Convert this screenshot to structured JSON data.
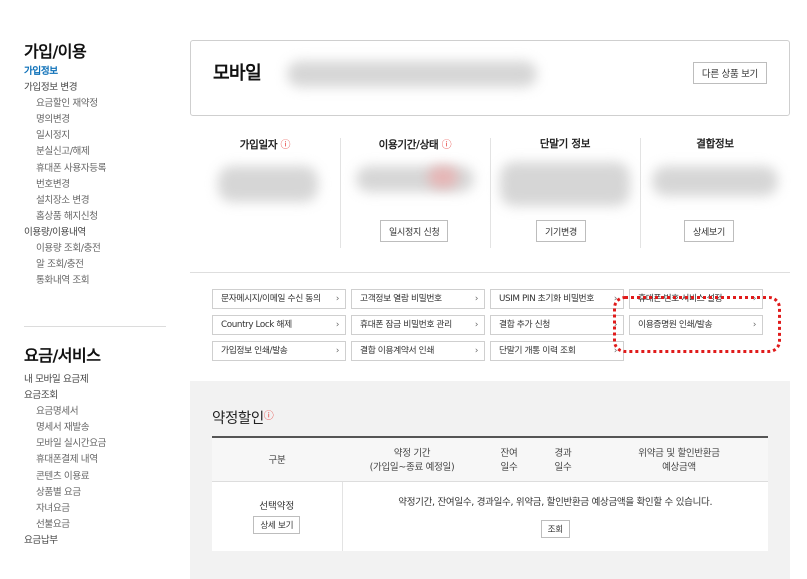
{
  "sidebar": {
    "section1_title": "가입/이용",
    "section1_items": [
      {
        "label": "가입정보",
        "level": 0,
        "active": true
      },
      {
        "label": "가입정보 변경",
        "level": 0
      },
      {
        "label": "요금할인 재약정",
        "level": 1
      },
      {
        "label": "명의변경",
        "level": 1
      },
      {
        "label": "일시정지",
        "level": 1
      },
      {
        "label": "분실신고/해제",
        "level": 1
      },
      {
        "label": "휴대폰 사용자등록",
        "level": 1
      },
      {
        "label": "번호변경",
        "level": 1
      },
      {
        "label": "설치장소 변경",
        "level": 1
      },
      {
        "label": "홈상품 해지신청",
        "level": 1
      },
      {
        "label": "이용량/이용내역",
        "level": 0
      },
      {
        "label": "이용량 조회/충전",
        "level": 1
      },
      {
        "label": "알 조회/충전",
        "level": 1
      },
      {
        "label": "통화내역 조회",
        "level": 1
      }
    ],
    "section2_title": "요금/서비스",
    "section2_items": [
      {
        "label": "내 모바일 요금제",
        "level": 0
      },
      {
        "label": "요금조회",
        "level": 0
      },
      {
        "label": "요금명세서",
        "level": 1
      },
      {
        "label": "명세서 재발송",
        "level": 1
      },
      {
        "label": "모바일 실시간요금",
        "level": 1
      },
      {
        "label": "휴대폰결제 내역",
        "level": 1
      },
      {
        "label": "콘텐츠 이용료",
        "level": 1
      },
      {
        "label": "상품별 요금",
        "level": 1
      },
      {
        "label": "자녀요금",
        "level": 1
      },
      {
        "label": "선불요금",
        "level": 1
      },
      {
        "label": "요금납부",
        "level": 0
      }
    ]
  },
  "product": {
    "title": "모바일",
    "other_button": "다른 상품 보기"
  },
  "info_columns": [
    {
      "title": "가입일자",
      "icon": "info-icon",
      "button": ""
    },
    {
      "title": "이용기간/상태",
      "icon": "info-icon",
      "button": "일시정지 신청"
    },
    {
      "title": "단말기 정보",
      "icon": "",
      "button": "기기변경"
    },
    {
      "title": "결합정보",
      "icon": "",
      "button": "상세보기"
    }
  ],
  "quick_links": [
    {
      "label": "문자메시지/이메일 수신 동의",
      "chevron": "›"
    },
    {
      "label": "고객정보 열람 비밀번호",
      "chevron": "›"
    },
    {
      "label": "USIM PIN 초기화 비밀번호",
      "chevron": "›"
    },
    {
      "label": "휴대폰 번호 서비스 설정",
      "chevron": "›"
    },
    {
      "label": "Country Lock 해제",
      "chevron": "›"
    },
    {
      "label": "휴대폰 잠금 비밀번호 관리",
      "chevron": "›"
    },
    {
      "label": "결합 추가 신청",
      "chevron": "›"
    },
    {
      "label": "이용증명원 인쇄/발송",
      "chevron": "›",
      "highlighted": true
    },
    {
      "label": "가입정보 인쇄/발송",
      "chevron": "›"
    },
    {
      "label": "결합 이용계약서 인쇄",
      "chevron": "›"
    },
    {
      "label": "단말기 개통 이력 조회",
      "chevron": "›"
    }
  ],
  "discount": {
    "title": "약정할인",
    "headers": {
      "category": "구분",
      "period_line1": "약정 기간",
      "period_line2": "(가입일~종료 예정일)",
      "remaining_line1": "잔여",
      "remaining_line2": "일수",
      "elapsed_line1": "경과",
      "elapsed_line2": "일수",
      "penalty_line1": "위약금 및 할인반환금",
      "penalty_line2": "예상금액"
    },
    "row": {
      "name": "선택약정",
      "detail_button": "상세 보기",
      "message": "약정기간, 잔여일수, 경과일수, 위약금, 할인반환금 예상금액을 확인할 수 있습니다.",
      "lookup_button": "조회"
    }
  },
  "colors": {
    "active_nav": "#0b6fb8",
    "highlight": "#e01b1b",
    "info_icon": "#e53935"
  }
}
